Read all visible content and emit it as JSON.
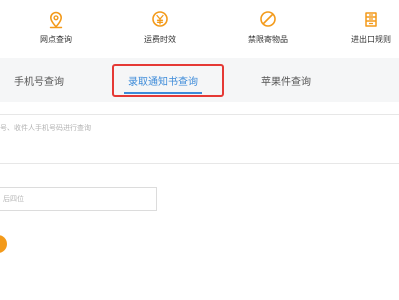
{
  "top_nav": {
    "items": [
      {
        "label": "网点查询",
        "icon": "location-icon"
      },
      {
        "label": "运费时效",
        "icon": "yuan-coin-icon"
      },
      {
        "label": "禁限寄物品",
        "icon": "prohibited-icon"
      },
      {
        "label": "进出口规则",
        "icon": "customs-rules-icon"
      }
    ]
  },
  "tabs": [
    {
      "label": "手机号查询",
      "active": false
    },
    {
      "label": "录取通知书查询",
      "active": true
    },
    {
      "label": "苹果件查询",
      "active": false
    }
  ],
  "query_hint": "号、收件人手机号码进行查询",
  "code_input": {
    "placeholder": "后四位"
  },
  "colors": {
    "accent": "#3d8bd9",
    "brand_orange": "#f39a1a",
    "highlight": "#e53935"
  }
}
